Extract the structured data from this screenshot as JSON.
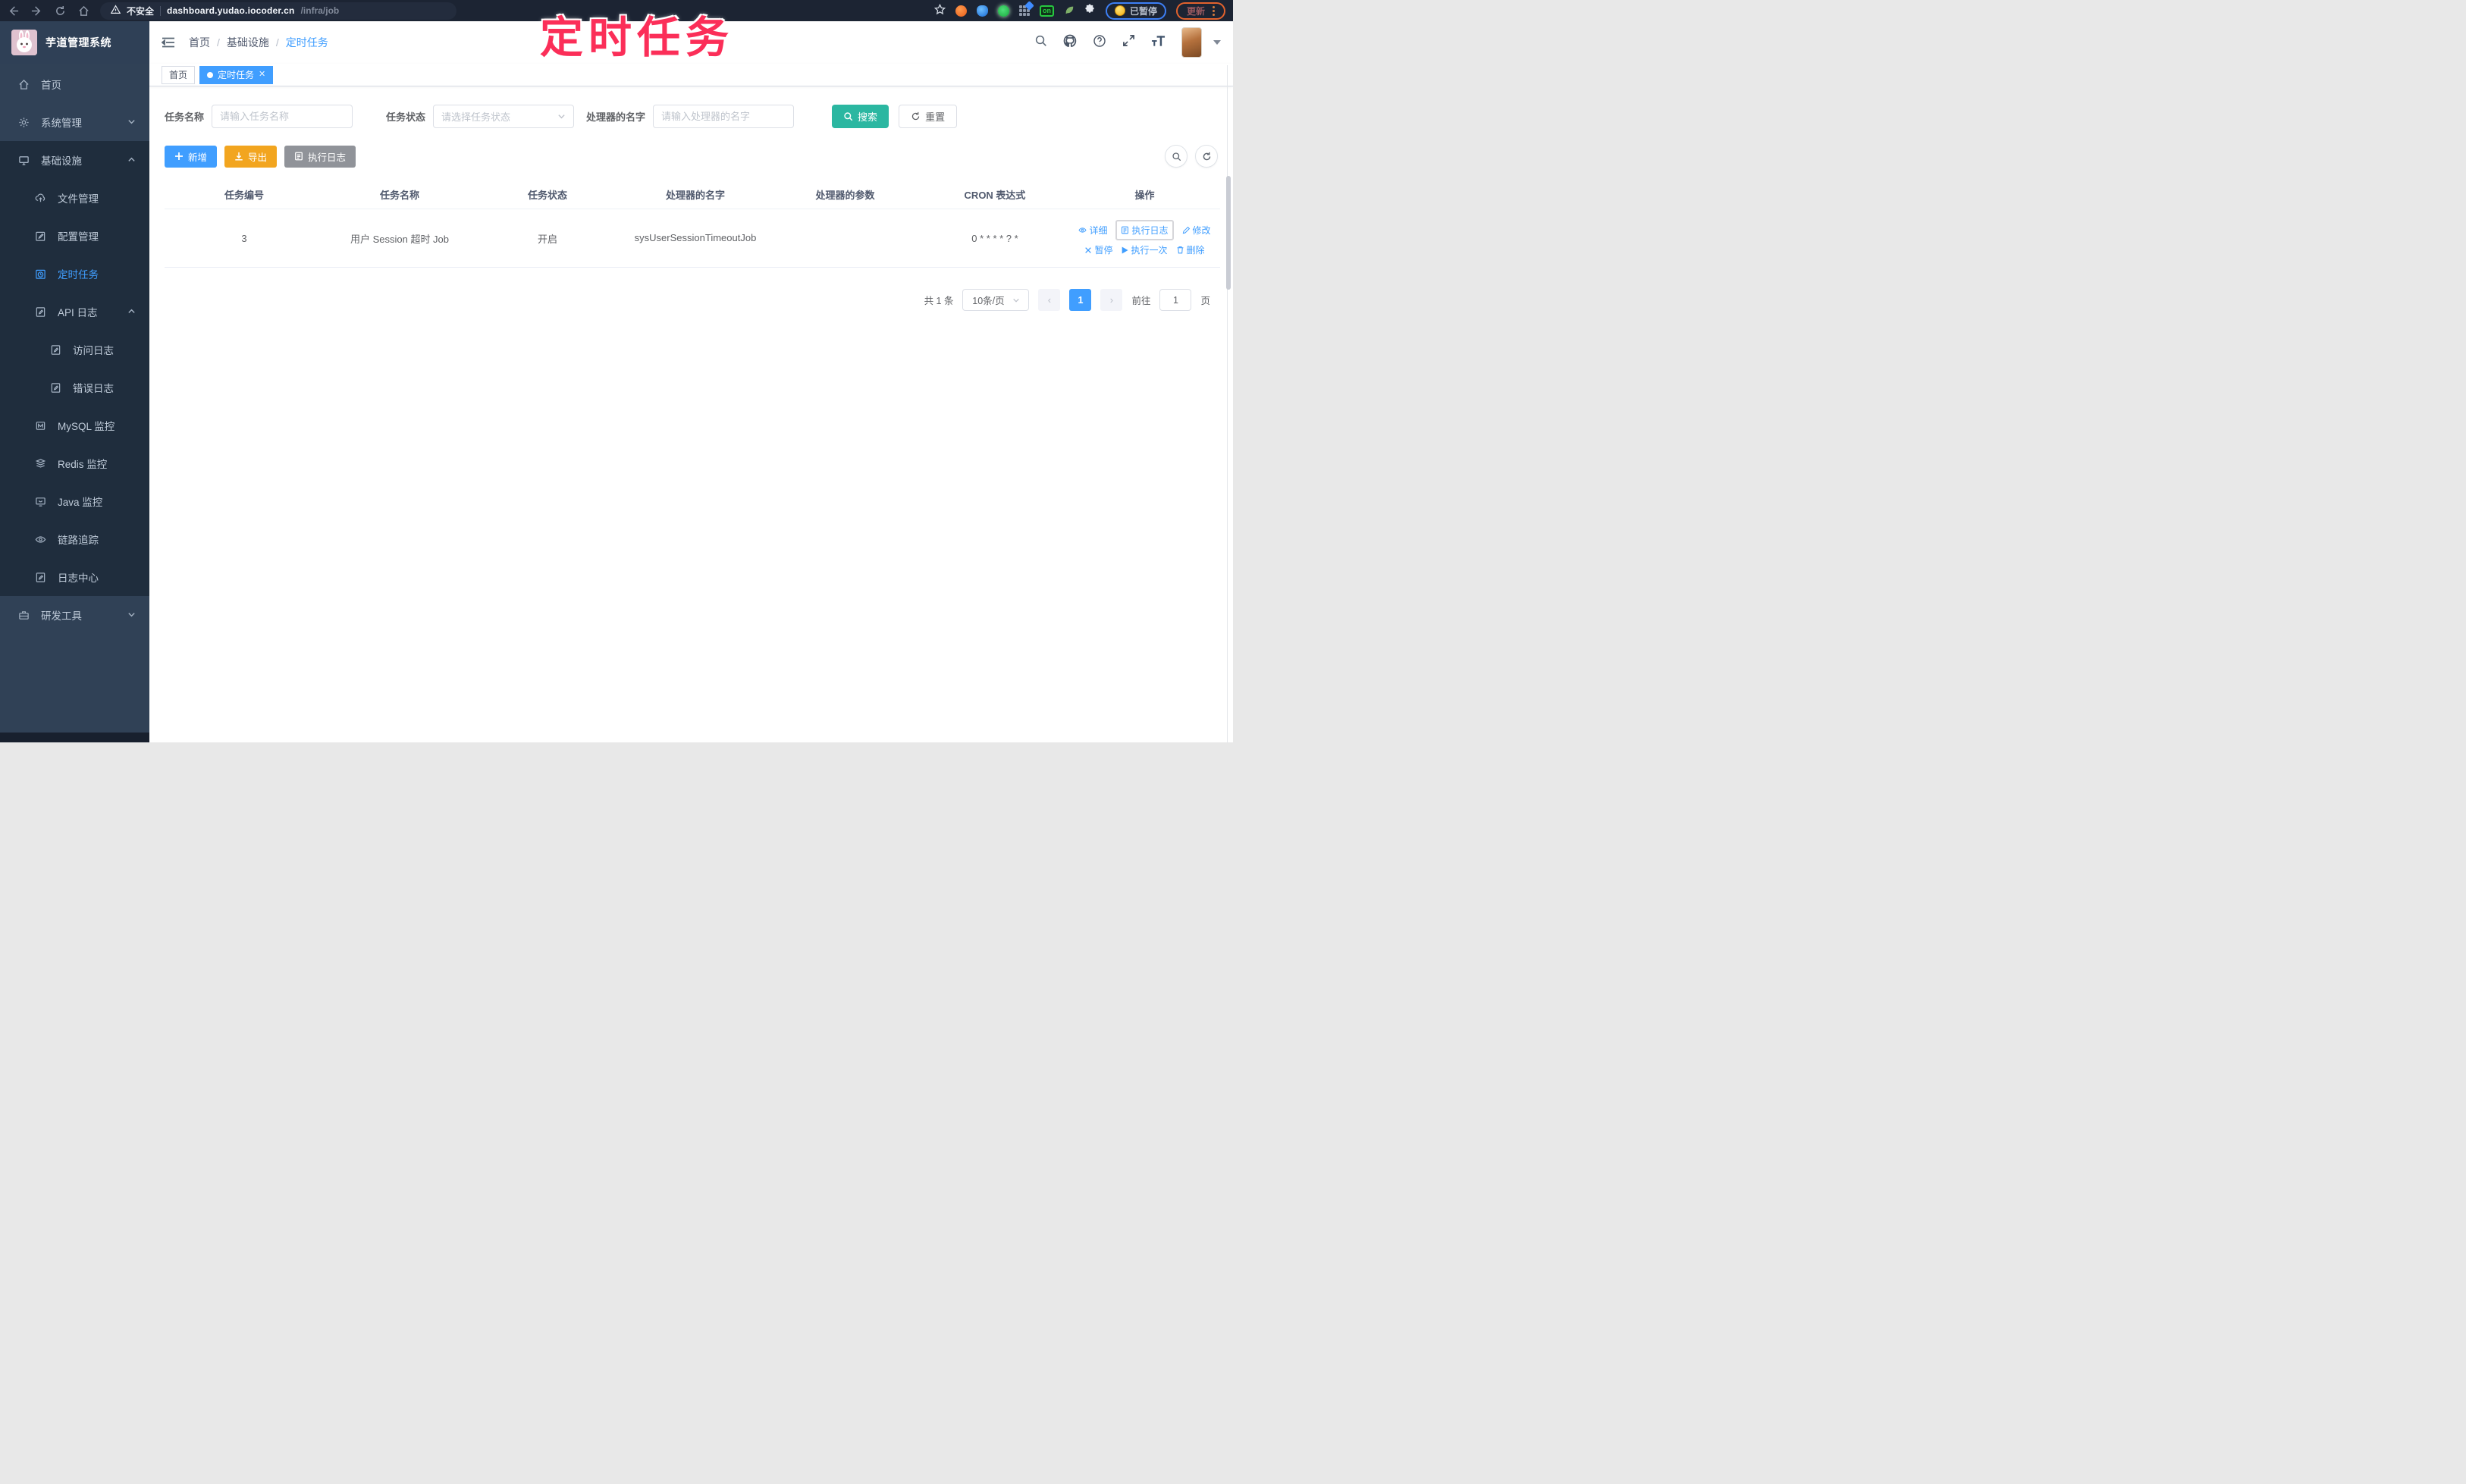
{
  "colors": {
    "accent": "#409eff",
    "search_button": "#2bb7a1",
    "export_button": "#f2a51f",
    "info_button": "#909399",
    "sidebar_bg": "#304156",
    "submenu_bg": "#1f2d3d",
    "annotation_pink": "#fb2e58",
    "active_tab": "#409eff"
  },
  "browser": {
    "security_label": "不安全",
    "url_host": "dashboard.yudao.iocoder.cn",
    "url_path": "/infra/job",
    "on_badge": "on",
    "paused_badge": "已暂停",
    "update_button": "更新"
  },
  "annotation": {
    "title": "定时任务"
  },
  "sidebar": {
    "app_title": "芋道管理系统",
    "items": [
      {
        "label": "首页"
      },
      {
        "label": "系统管理"
      },
      {
        "label": "基础设施"
      },
      {
        "label": "文件管理"
      },
      {
        "label": "配置管理"
      },
      {
        "label": "定时任务"
      },
      {
        "label": "API 日志"
      },
      {
        "label": "访问日志"
      },
      {
        "label": "错误日志"
      },
      {
        "label": "MySQL 监控"
      },
      {
        "label": "Redis 监控"
      },
      {
        "label": "Java 监控"
      },
      {
        "label": "链路追踪"
      },
      {
        "label": "日志中心"
      },
      {
        "label": "研发工具"
      }
    ]
  },
  "topbar": {
    "breadcrumb": [
      "首页",
      "基础设施",
      "定时任务"
    ],
    "separator": "/"
  },
  "tabs": [
    {
      "label": "首页"
    },
    {
      "label": "定时任务"
    }
  ],
  "filters": {
    "name_label": "任务名称",
    "name_placeholder": "请输入任务名称",
    "status_label": "任务状态",
    "status_placeholder": "请选择任务状态",
    "handler_label": "处理器的名字",
    "handler_placeholder": "请输入处理器的名字",
    "search_label": "搜索",
    "reset_label": "重置"
  },
  "toolbar": {
    "add_label": "新增",
    "export_label": "导出",
    "exec_log_label": "执行日志"
  },
  "table": {
    "headers": [
      "任务编号",
      "任务名称",
      "任务状态",
      "处理器的名字",
      "处理器的参数",
      "CRON 表达式",
      "操作"
    ],
    "row": {
      "id": "3",
      "name": "用户 Session 超时 Job",
      "status": "开启",
      "handler": "sysUserSessionTimeoutJob",
      "param": "",
      "cron": "0 * * * * ? *"
    },
    "actions_line1": [
      "详细",
      "执行日志",
      "修改"
    ],
    "actions_line2": [
      "暂停",
      "执行一次",
      "删除"
    ]
  },
  "pagination": {
    "total": "共 1 条",
    "page_size": "10条/页",
    "current": "1",
    "goto_label": "前往",
    "goto_value": "1",
    "unit": "页"
  }
}
